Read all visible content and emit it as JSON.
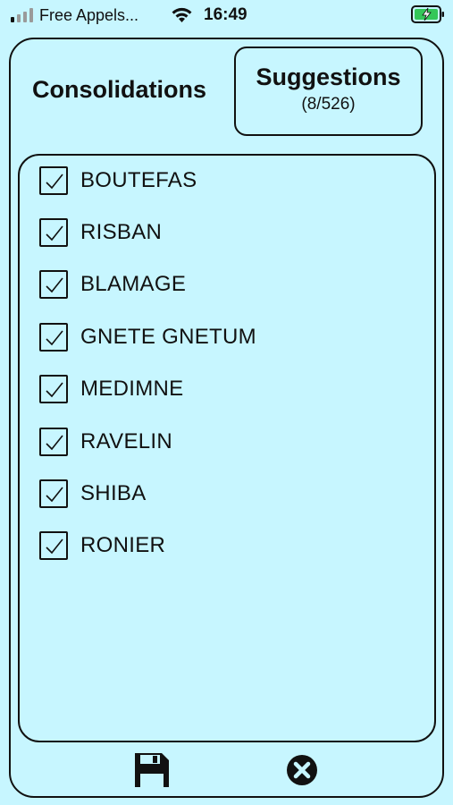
{
  "status_bar": {
    "carrier": "Free Appels...",
    "time": "16:49",
    "signal_icon": "cellular-signal-icon",
    "wifi_icon": "wifi-icon",
    "battery_icon": "battery-charging-icon"
  },
  "header": {
    "consolidations_label": "Consolidations",
    "suggestions_label": "Suggestions",
    "suggestions_count": "(8/526)"
  },
  "items": [
    {
      "label": "BOUTEFAS",
      "checked": true
    },
    {
      "label": "RISBAN",
      "checked": true
    },
    {
      "label": "BLAMAGE",
      "checked": true
    },
    {
      "label": "GNETE GNETUM",
      "checked": true
    },
    {
      "label": "MEDIMNE",
      "checked": true
    },
    {
      "label": "RAVELIN",
      "checked": true
    },
    {
      "label": "SHIBA",
      "checked": true
    },
    {
      "label": "RONIER",
      "checked": true
    }
  ],
  "footer": {
    "save_icon": "floppy-disk-icon",
    "close_icon": "close-circle-icon"
  },
  "colors": {
    "background": "#c7f6ff",
    "battery_charge": "#34c759"
  }
}
